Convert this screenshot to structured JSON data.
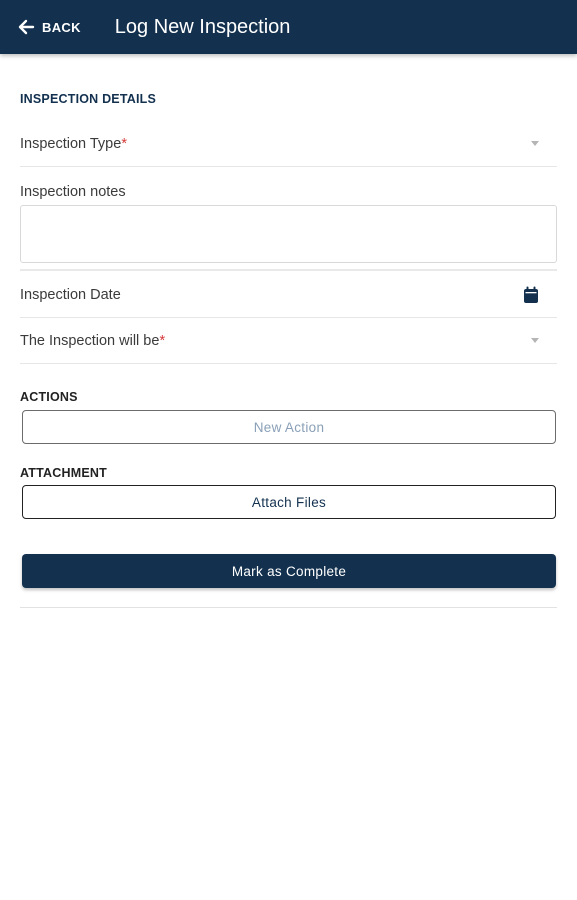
{
  "appbar": {
    "back_label": "BACK",
    "title": "Log New Inspection",
    "bg_color": "#13314f"
  },
  "inspection_details": {
    "heading": "INSPECTION DETAILS",
    "type_label": "Inspection Type",
    "notes_label": "Inspection notes",
    "notes_value": "",
    "date_label": "Inspection Date",
    "will_be_label": "The Inspection will be",
    "required_mark": "*"
  },
  "actions": {
    "heading": "ACTIONS",
    "new_action_label": "New Action"
  },
  "attachment": {
    "heading": "ATTACHMENT",
    "attach_label": "Attach Files"
  },
  "complete_label": "Mark as Complete",
  "icons": {
    "back": "arrow-left-icon",
    "dropdown": "caret-down-icon",
    "calendar": "calendar-icon"
  },
  "colors": {
    "primary": "#13314f",
    "required": "#d63a3a"
  }
}
